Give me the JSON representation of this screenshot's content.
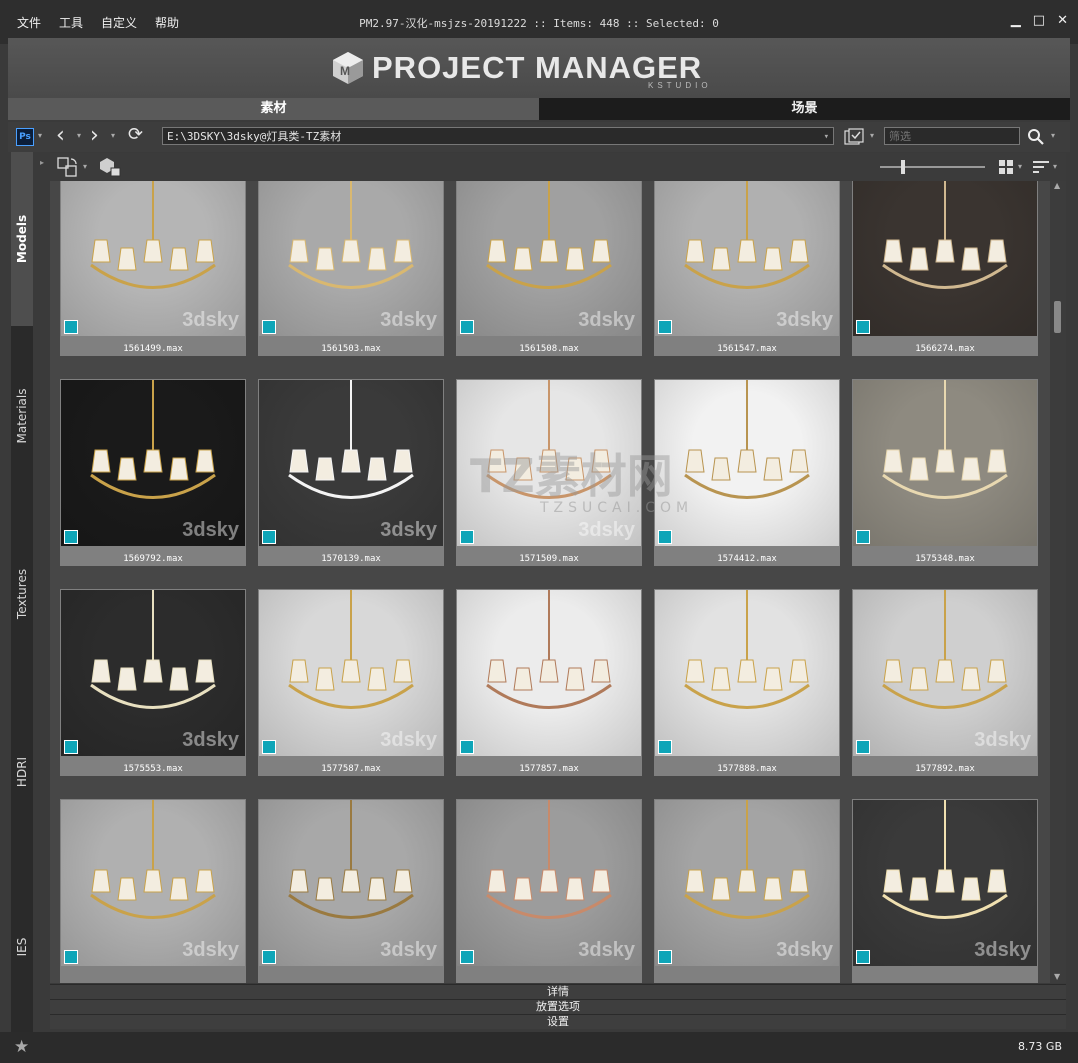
{
  "menu": [
    "文件",
    "工具",
    "自定义",
    "帮助"
  ],
  "window_title": "PM2.97-汉化-msjzs-20191222  :: Items: 448  :: Selected: 0",
  "window_controls": {
    "minimize": "▁",
    "maximize": "□",
    "close": "✕"
  },
  "logo": {
    "text": "PROJECT MANAGER",
    "sub": "KSTUDIO"
  },
  "tabs": [
    {
      "label": "素材",
      "active": true
    },
    {
      "label": "场景",
      "active": false
    }
  ],
  "toolbar": {
    "ps_label": "Ps",
    "back_icon": "‹",
    "forward_icon": "›",
    "refresh_icon": "⟳",
    "path": "E:\\3DSKY\\3dsky@灯具类-TZ素材",
    "filter_placeholder": "筛选",
    "search_icon": "⚲"
  },
  "side_tabs": [
    {
      "label": "Models",
      "active": true
    },
    {
      "label": "Materials",
      "active": false
    },
    {
      "label": "Textures",
      "active": false
    },
    {
      "label": "HDRI",
      "active": false
    },
    {
      "label": "IES",
      "active": false
    }
  ],
  "zoom_slider_level": 0.2,
  "items": [
    {
      "name": "1561499.max",
      "bg": "#b5b5b5",
      "accent": "#c9a24a",
      "wm": "3dsky"
    },
    {
      "name": "1561503.max",
      "bg": "#a9a9a9",
      "accent": "#d9b870",
      "wm": "3dsky"
    },
    {
      "name": "1561508.max",
      "bg": "#a0a0a0",
      "accent": "#c9a24a",
      "wm": "3dsky"
    },
    {
      "name": "1561547.max",
      "bg": "#b0b0b0",
      "accent": "#c9a24a",
      "wm": "3dsky"
    },
    {
      "name": "1566274.max",
      "bg": "#3a3430",
      "accent": "#d0b890",
      "wm": ""
    },
    {
      "name": "1569792.max",
      "bg": "#1a1a1a",
      "accent": "#c9a24a",
      "wm": "3dsky"
    },
    {
      "name": "1570139.max",
      "bg": "#3a3a3a",
      "accent": "#f4f4f4",
      "wm": "3dsky"
    },
    {
      "name": "1571509.max",
      "bg": "#e6e6e6",
      "accent": "#c8956a",
      "wm": "3dsky"
    },
    {
      "name": "1574412.max",
      "bg": "#f2f2f2",
      "accent": "#b89450",
      "wm": ""
    },
    {
      "name": "1575348.max",
      "bg": "#8e8a80",
      "accent": "#e8d8b0",
      "wm": ""
    },
    {
      "name": "1575553.max",
      "bg": "#2c2c2c",
      "accent": "#e8e0c0",
      "wm": "3dsky"
    },
    {
      "name": "1577587.max",
      "bg": "#d8d8d8",
      "accent": "#c9a24a",
      "wm": "3dsky"
    },
    {
      "name": "1577857.max",
      "bg": "#ececec",
      "accent": "#b07a5a",
      "wm": ""
    },
    {
      "name": "1577888.max",
      "bg": "#e2e2e2",
      "accent": "#c9a24a",
      "wm": ""
    },
    {
      "name": "1577892.max",
      "bg": "#cfcfcf",
      "accent": "#c9a24a",
      "wm": "3dsky"
    },
    {
      "name": "",
      "bg": "#b0b0b0",
      "accent": "#c9a24a",
      "wm": "3dsky"
    },
    {
      "name": "",
      "bg": "#a8a8a8",
      "accent": "#9a7a40",
      "wm": "3dsky"
    },
    {
      "name": "",
      "bg": "#9c9c9c",
      "accent": "#c88a6a",
      "wm": "3dsky"
    },
    {
      "name": "",
      "bg": "#a4a4a4",
      "accent": "#c9a24a",
      "wm": "3dsky"
    },
    {
      "name": "",
      "bg": "#3a3a3a",
      "accent": "#f0e0b0",
      "wm": "3dsky"
    }
  ],
  "watermark": {
    "main": "TZ素材网",
    "sub": "TZSUCAI.COM"
  },
  "panels": [
    "详情",
    "放置选项",
    "设置"
  ],
  "status": {
    "star_icon": "★",
    "size": "8.73 GB"
  }
}
